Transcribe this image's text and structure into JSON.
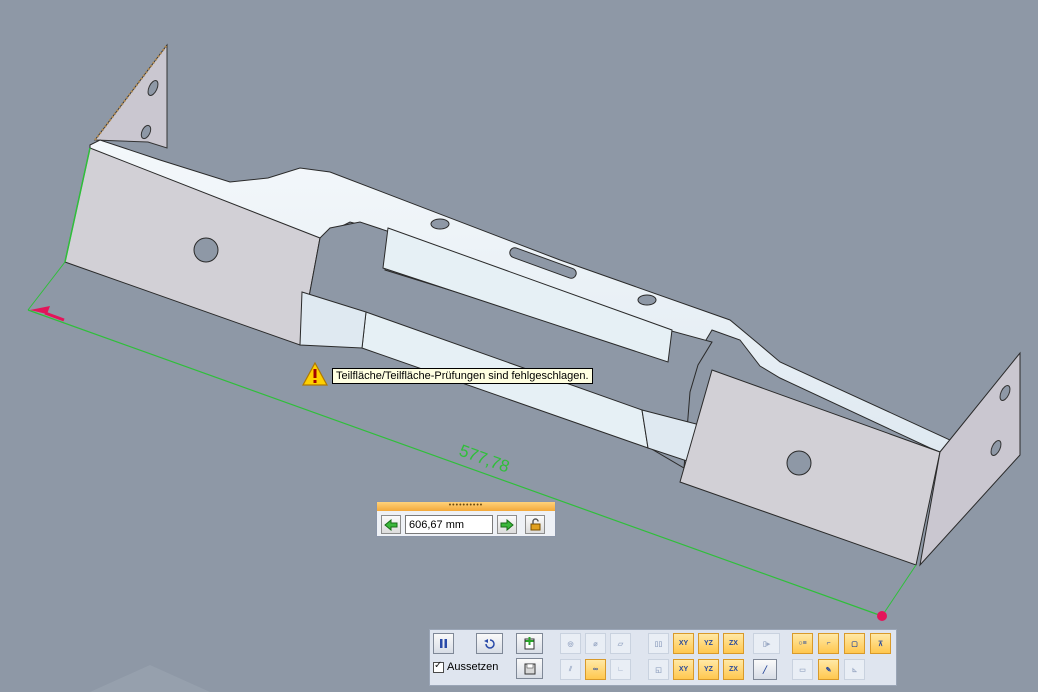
{
  "dimension": {
    "value_label": "577,78",
    "color": "#2fbf3a"
  },
  "warning": {
    "text": "Teilfläche/Teilfläche-Prüfungen sind fehlgeschlagen.",
    "icon": "warning-icon"
  },
  "value_entry": {
    "grip": "••••••••••",
    "value": "606,67 mm",
    "prev_icon": "arrow-left-icon",
    "next_icon": "arrow-right-icon",
    "lock_icon": "lock-icon"
  },
  "command_bar": {
    "pause_icon": "pause-icon",
    "reset_icon": "undo-icon",
    "add_icon": "add-document-icon",
    "save_icon": "save-icon",
    "suspend_label": "Aussetzen",
    "suspend_checked": true,
    "xy": "XY",
    "yz": "YZ",
    "zx": "ZX"
  },
  "colors": {
    "background": "#8e98a6",
    "part_face": "#eaf2f8",
    "part_side": "#d0cfd6",
    "highlight": "#ffc74f",
    "accent_pink": "#e4145a"
  }
}
